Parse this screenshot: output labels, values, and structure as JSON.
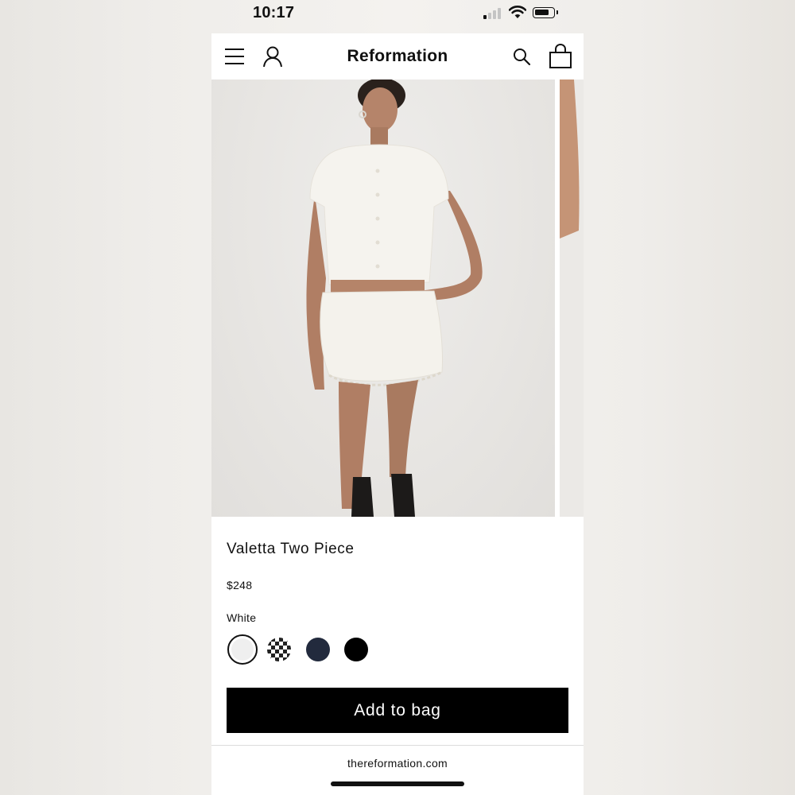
{
  "status_bar": {
    "time": "10:17"
  },
  "header": {
    "brand": "Reformation",
    "icons": [
      "menu-icon",
      "account-icon",
      "search-icon",
      "bag-icon"
    ]
  },
  "product": {
    "title": "Valetta Two Piece",
    "price": "$248",
    "selected_color": "White",
    "swatches": [
      {
        "name": "White",
        "color": "#efefef",
        "selected": true
      },
      {
        "name": "Gingham",
        "pattern": "black-and-white check",
        "selected": false
      },
      {
        "name": "Navy",
        "color": "#222a3d",
        "selected": false
      },
      {
        "name": "Black",
        "color": "#000000",
        "selected": false
      }
    ],
    "add_to_bag_label": "Add to bag"
  },
  "browser": {
    "url": "thereformation.com"
  }
}
